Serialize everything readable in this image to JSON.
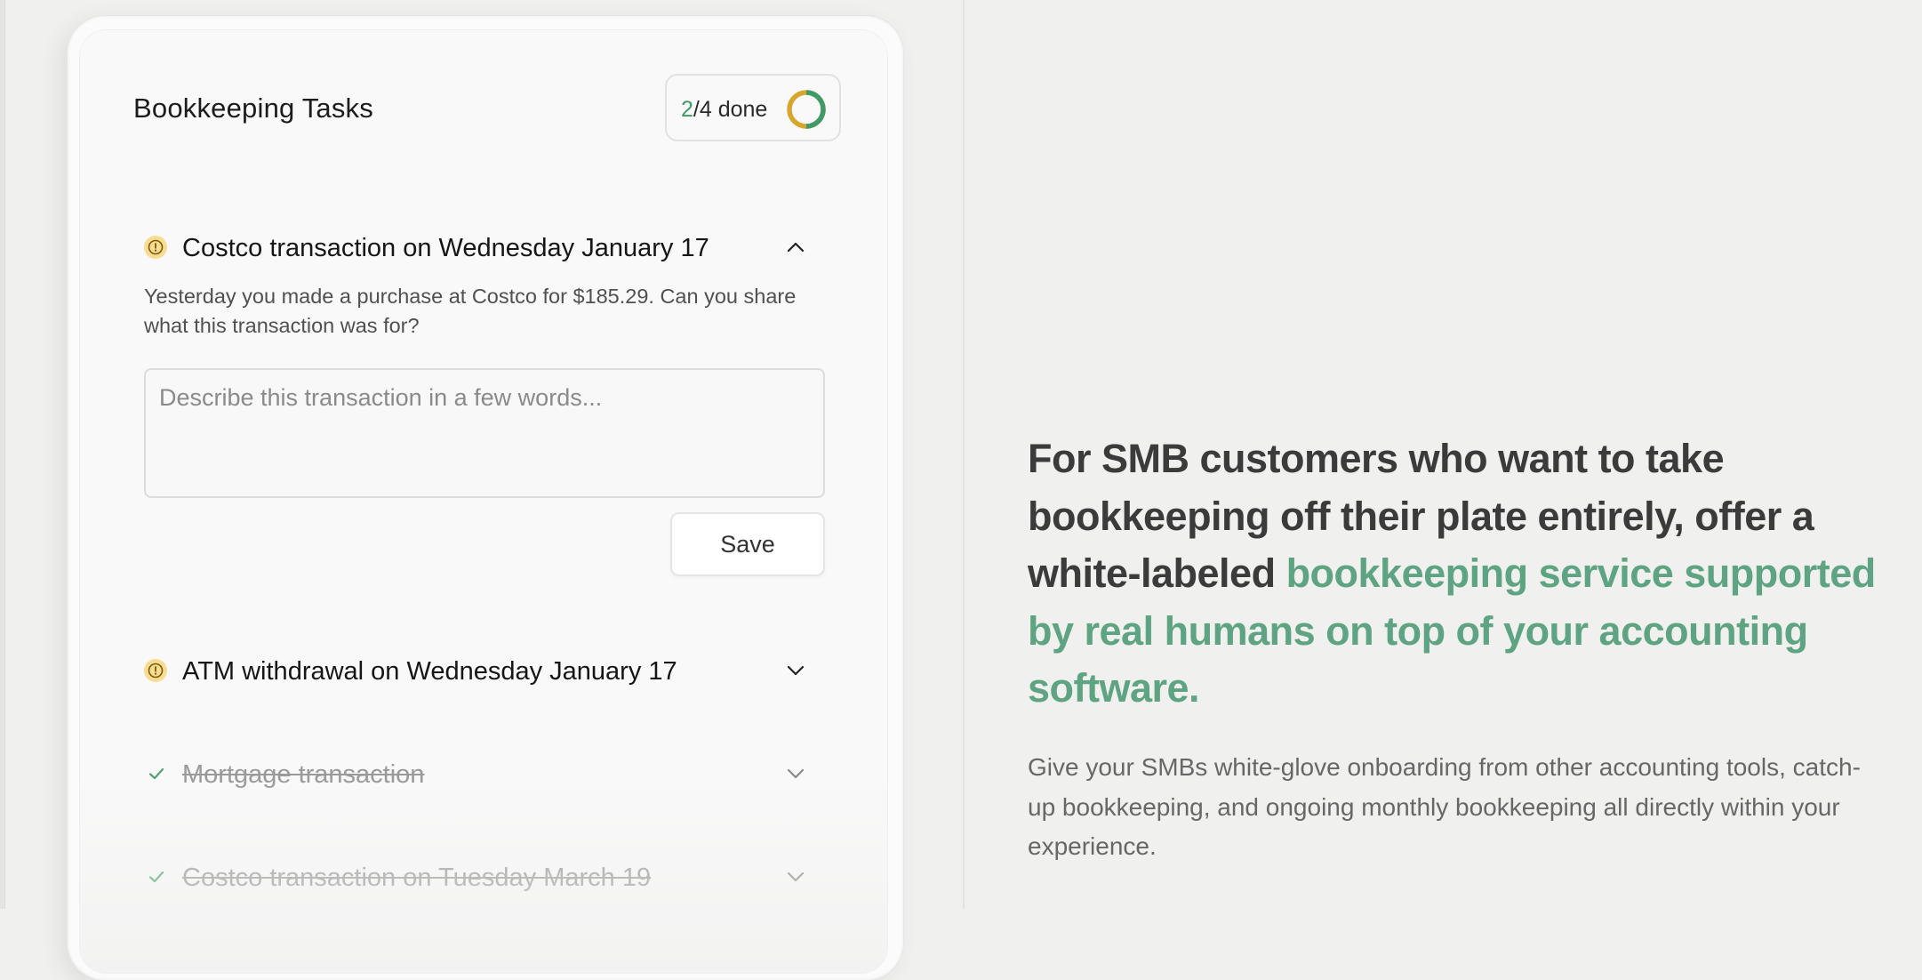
{
  "tasks_card": {
    "title": "Bookkeeping Tasks",
    "progress": {
      "done": "2",
      "total_text": "/4 done",
      "done_fraction": 0.5,
      "done_color": "#3f9a67",
      "pending_color": "#d8a62c"
    },
    "tasks": [
      {
        "label": "Costco transaction on Wednesday January 17",
        "status": "pending",
        "status_icon": "alert-circle-icon",
        "expanded": true,
        "chevron": "chevron-up-icon",
        "description": "Yesterday you made a purchase at Costco for $185.29. Can you share what this transaction was for?",
        "input": {
          "value": "",
          "placeholder": "Describe this transaction in a few words..."
        },
        "save_label": "Save"
      },
      {
        "label": "ATM withdrawal on Wednesday January 17",
        "status": "pending",
        "status_icon": "alert-circle-icon",
        "expanded": false,
        "chevron": "chevron-down-icon"
      },
      {
        "label": "Mortgage transaction",
        "status": "done",
        "status_icon": "check-icon",
        "expanded": false,
        "chevron": "chevron-down-icon"
      },
      {
        "label": "Costco transaction on Tuesday March 19",
        "status": "done",
        "status_icon": "check-icon",
        "expanded": false,
        "chevron": "chevron-down-icon"
      }
    ]
  },
  "marketing": {
    "headline_plain": "For SMB customers who want to take bookkeeping off their plate entirely, offer a white-labeled ",
    "headline_accent": "bookkeeping service supported by real humans on top of your accounting software.",
    "accent_color": "#5fa482",
    "subcopy": "Give your SMBs white-glove onboarding from other accounting tools, catch-up bookkeeping, and ongoing monthly bookkeeping all directly within your experience."
  }
}
